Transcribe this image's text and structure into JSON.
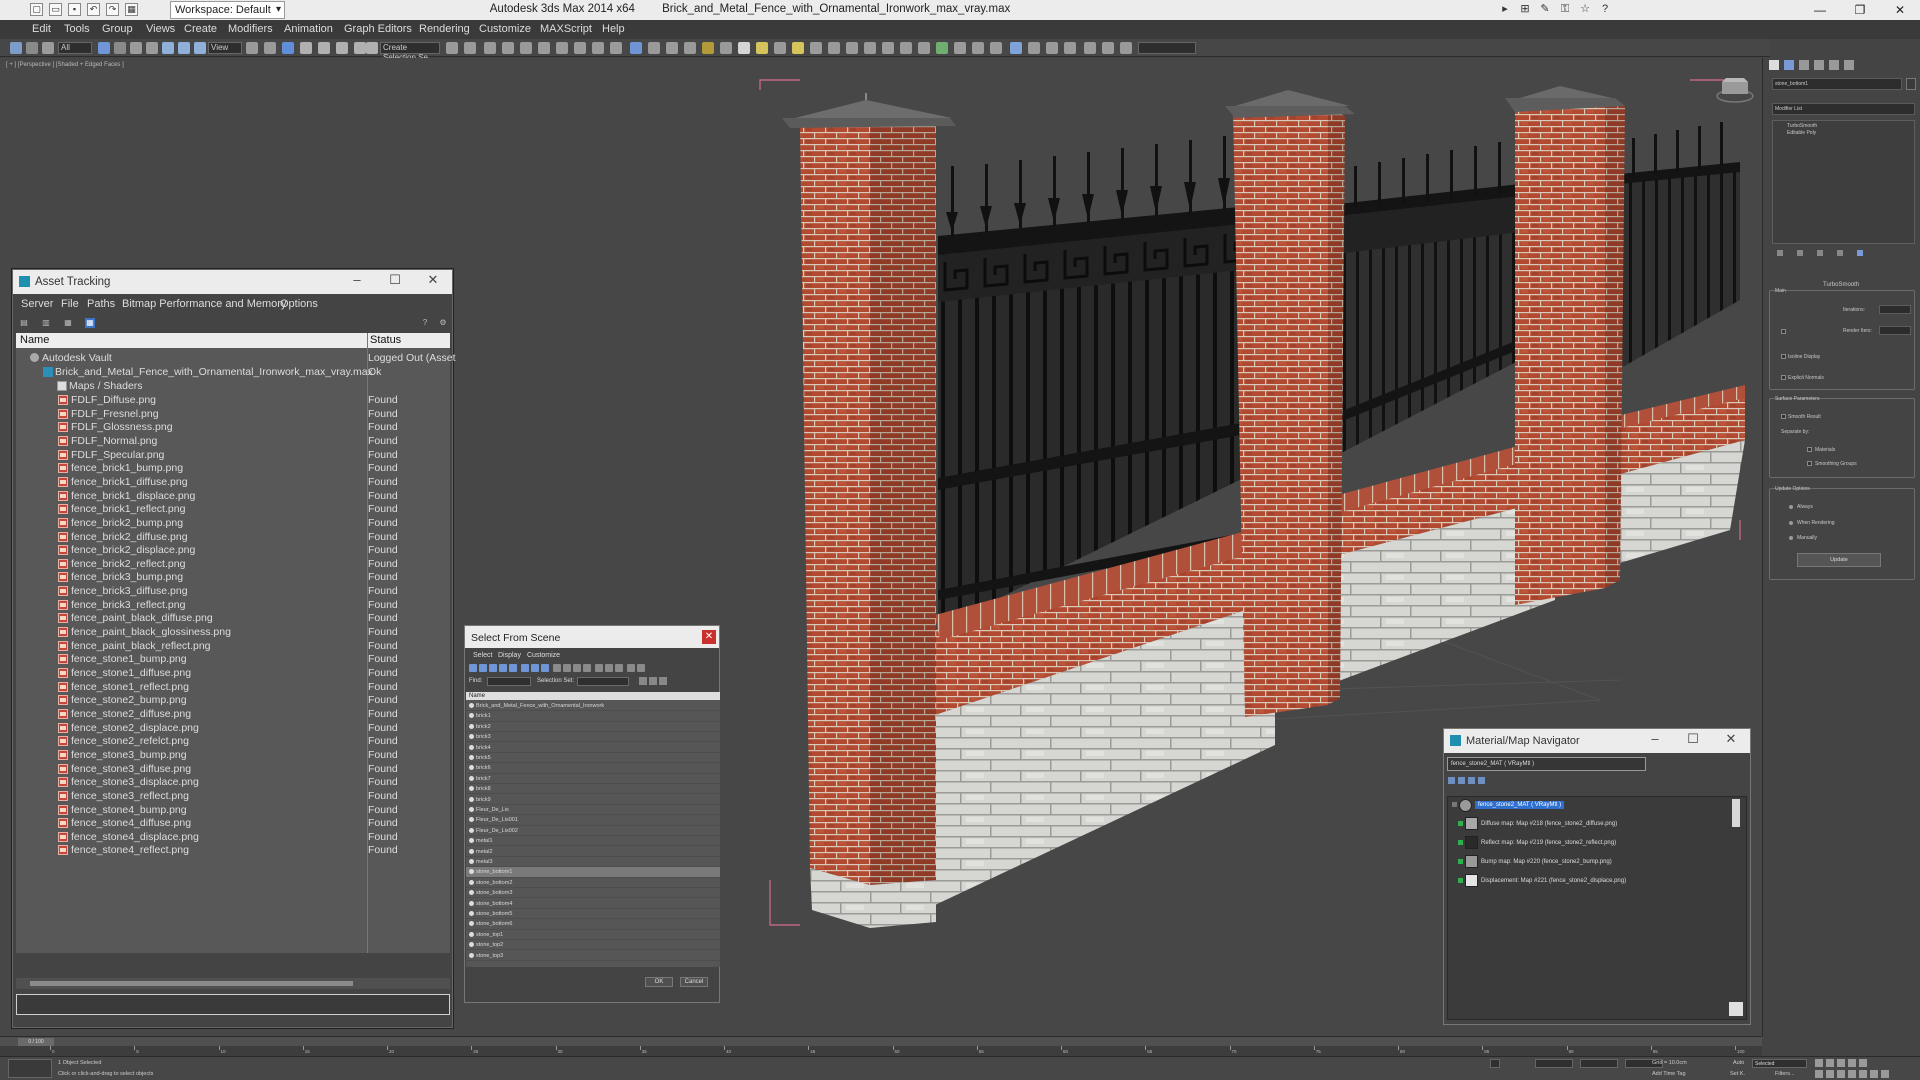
{
  "window": {
    "app_title": "Autodesk 3ds Max  2014 x64",
    "file_title": "Brick_and_Metal_Fence_with_Ornamental_Ironwork_max_vray.max",
    "workspace": "Workspace: Default"
  },
  "menubar": [
    "Edit",
    "Tools",
    "Group",
    "Views",
    "Create",
    "Modifiers",
    "Animation",
    "Graph Editors",
    "Rendering",
    "Customize",
    "MAXScript",
    "Help"
  ],
  "toolbar": {
    "all_dropdown": "All",
    "view_dropdown": "View",
    "selection_set": "Create Selection Se"
  },
  "viewport": {
    "label": "[ + ] [Perspective ] [Shaded + Edged Faces ]"
  },
  "command_panel": {
    "object_name": "stone_bottom1",
    "modifier_list": "Modifier List",
    "stack": [
      "TurboSmooth",
      "Editable Poly"
    ],
    "rollout_title": "TurboSmooth",
    "main": "Main",
    "iterations": "Iterations:",
    "render_iters": "Render Iters:",
    "isoline": "Isoline Display",
    "explicit_normals": "Explicit Normals",
    "surface_params": "Surface Parameters",
    "smooth_result": "Smooth Result",
    "separate_by": "Separate by:",
    "materials": "Materials",
    "smoothing_groups": "Smoothing Groups",
    "update_options": "Update Options",
    "always": "Always",
    "when_rendering": "When Rendering",
    "manually": "Manually",
    "update": "Update"
  },
  "asset_tracking": {
    "title": "Asset Tracking",
    "menu": [
      "Server",
      "File",
      "Paths",
      "Bitmap Performance and Memory",
      "Options"
    ],
    "col_name": "Name",
    "col_status": "Status",
    "vault": {
      "name": "Autodesk Vault",
      "status": "Logged Out (Asset"
    },
    "max_file": {
      "name": "Brick_and_Metal_Fence_with_Ornamental_Ironwork_max_vray.max",
      "status": "Ok"
    },
    "maps_folder": "Maps / Shaders",
    "maps": [
      {
        "name": "FDLF_Diffuse.png",
        "status": "Found"
      },
      {
        "name": "FDLF_Fresnel.png",
        "status": "Found"
      },
      {
        "name": "FDLF_Glossness.png",
        "status": "Found"
      },
      {
        "name": "FDLF_Normal.png",
        "status": "Found"
      },
      {
        "name": "FDLF_Specular.png",
        "status": "Found"
      },
      {
        "name": "fence_brick1_bump.png",
        "status": "Found"
      },
      {
        "name": "fence_brick1_diffuse.png",
        "status": "Found"
      },
      {
        "name": "fence_brick1_displace.png",
        "status": "Found"
      },
      {
        "name": "fence_brick1_reflect.png",
        "status": "Found"
      },
      {
        "name": "fence_brick2_bump.png",
        "status": "Found"
      },
      {
        "name": "fence_brick2_diffuse.png",
        "status": "Found"
      },
      {
        "name": "fence_brick2_displace.png",
        "status": "Found"
      },
      {
        "name": "fence_brick2_reflect.png",
        "status": "Found"
      },
      {
        "name": "fence_brick3_bump.png",
        "status": "Found"
      },
      {
        "name": "fence_brick3_diffuse.png",
        "status": "Found"
      },
      {
        "name": "fence_brick3_reflect.png",
        "status": "Found"
      },
      {
        "name": "fence_paint_black_diffuse.png",
        "status": "Found"
      },
      {
        "name": "fence_paint_black_glossiness.png",
        "status": "Found"
      },
      {
        "name": "fence_paint_black_reflect.png",
        "status": "Found"
      },
      {
        "name": "fence_stone1_bump.png",
        "status": "Found"
      },
      {
        "name": "fence_stone1_diffuse.png",
        "status": "Found"
      },
      {
        "name": "fence_stone1_reflect.png",
        "status": "Found"
      },
      {
        "name": "fence_stone2_bump.png",
        "status": "Found"
      },
      {
        "name": "fence_stone2_diffuse.png",
        "status": "Found"
      },
      {
        "name": "fence_stone2_displace.png",
        "status": "Found"
      },
      {
        "name": "fence_stone2_refelct.png",
        "status": "Found"
      },
      {
        "name": "fence_stone3_bump.png",
        "status": "Found"
      },
      {
        "name": "fence_stone3_diffuse.png",
        "status": "Found"
      },
      {
        "name": "fence_stone3_displace.png",
        "status": "Found"
      },
      {
        "name": "fence_stone3_reflect.png",
        "status": "Found"
      },
      {
        "name": "fence_stone4_bump.png",
        "status": "Found"
      },
      {
        "name": "fence_stone4_diffuse.png",
        "status": "Found"
      },
      {
        "name": "fence_stone4_displace.png",
        "status": "Found"
      },
      {
        "name": "fence_stone4_reflect.png",
        "status": "Found"
      }
    ]
  },
  "select_from_scene": {
    "title": "Select From Scene",
    "menu": [
      "Select",
      "Display",
      "Customize"
    ],
    "find_label": "Find:",
    "selection_set": "Selection Set:",
    "col_name": "Name",
    "items": [
      "Brick_and_Metal_Fence_with_Ornamental_Ironwork",
      "brick1",
      "brick2",
      "brick3",
      "brick4",
      "brick5",
      "brick6",
      "brick7",
      "brick8",
      "brick9",
      "Fleur_De_Lis",
      "Fleur_De_Lis001",
      "Fleur_De_Lis002",
      "metal1",
      "metal2",
      "metal3",
      "stone_bottom1",
      "stone_bottom2",
      "stone_bottom3",
      "stone_bottom4",
      "stone_bottom5",
      "stone_bottom6",
      "stone_top1",
      "stone_top2",
      "stone_top3"
    ],
    "selected": "stone_bottom1",
    "ok": "OK",
    "cancel": "Cancel"
  },
  "material_navigator": {
    "title": "Material/Map Navigator",
    "name_field": "fence_stone2_MAT  ( VRayMtl )",
    "root": "fence_stone2_MAT  ( VRayMtl )",
    "maps": [
      {
        "label": "Diffuse map: Map #218 (fence_stone2_diffuse.png)",
        "color": "#a8a8a8"
      },
      {
        "label": "Reflect map: Map #219 (fence_stone2_reflect.png)",
        "color": "#2a2a2a"
      },
      {
        "label": "Bump map: Map #220 (fence_stone2_bump.png)",
        "color": "#9a9a9a"
      },
      {
        "label": "Displacement: Map #221 (fence_stone2_displace.png)",
        "color": "#e4e4e4"
      }
    ]
  },
  "timeline": {
    "frame_label": "0 / 100",
    "ticks": [
      "0",
      "5",
      "10",
      "15",
      "20",
      "25",
      "30",
      "35",
      "40",
      "45",
      "50",
      "55",
      "60",
      "65",
      "70",
      "75",
      "80",
      "85",
      "90",
      "95",
      "100"
    ]
  },
  "status": {
    "objects_selected": "1 Object Selected",
    "prompt": "Click or click-and-drag to select objects",
    "grid": "Grid = 10.0cm",
    "add_time_tag": "Add Time Tag",
    "auto": "Auto",
    "set_k": "Set K.",
    "selected": "Selected",
    "filters": "Filters..."
  }
}
